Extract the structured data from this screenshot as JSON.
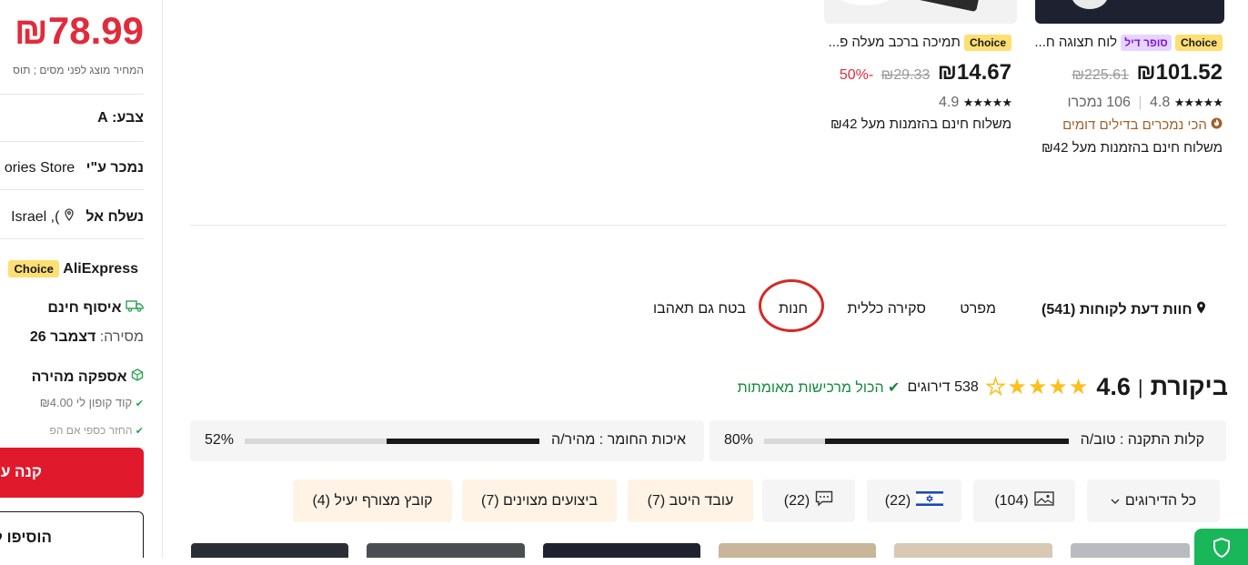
{
  "left_panel": {
    "price": "₪78.99",
    "price_note": "המחיר מוצג לפני מסים ; תוס",
    "color_label": "צבע:",
    "color_value": "A",
    "sold_by_label": "נמכר ע\"י",
    "store_name": "ories Store",
    "ship_to_label": "נשלח אל",
    "ship_to_value": "), Israel",
    "choice_badge": "Choice",
    "aliexpress": "AliExpress",
    "free_pickup": "איסוף חינם",
    "delivery_label": "מסירה:",
    "delivery_date": "דצמבר 26",
    "fast_delivery": "אספקה מהירה",
    "coupon_text": "קוד קופון לי",
    "coupon_amount": "₪4.00",
    "refund_text": "החזר כספי אם הפ",
    "buy_button": "קנה ע",
    "add_button": "הוסיפו ל"
  },
  "cards": [
    {
      "badge": "Choice",
      "superdeal": "סופר דיל",
      "title": "לוח תצוגה ח...",
      "price": "₪101.52",
      "old_price": "₪225.61",
      "stars": "★★★★★",
      "rating": "4.8",
      "sold": "106 נמכרו",
      "best_seller": "הכי נמכרים בדילים דומים",
      "shipping": "משלוח חינם בהזמנות מעל ₪42"
    },
    {
      "badge": "Choice",
      "title": "תמיכה ברכב מעלה פ...",
      "price": "₪14.67",
      "old_price": "₪29.33",
      "discount": "-50%",
      "stars": "★★★★★",
      "rating": "4.9",
      "shipping": "משלוח חינם בהזמנות מעל ₪42"
    }
  ],
  "tabs": [
    {
      "label": "חוות דעת לקוחות (541)"
    },
    {
      "label": "מפרט"
    },
    {
      "label": "סקירה כללית"
    },
    {
      "label": "חנות"
    },
    {
      "label": "בטח גם תאהבו"
    }
  ],
  "review": {
    "title": "ביקורת",
    "score": "4.6",
    "stars": "★★★★",
    "half_star": "★",
    "count": "538 דירוגים",
    "verified": "הכול מרכישות מאומתות",
    "bars": [
      {
        "label": "קלות התקנה : טוב/ה",
        "percent": "80%",
        "value": 0.8
      },
      {
        "label": "איכות החומר : מהיר/ה",
        "percent": "52%",
        "value": 0.52
      }
    ]
  },
  "filters": [
    {
      "label": "כל הדירוגים",
      "icon": "chevron-down-icon"
    },
    {
      "label": "(104)",
      "icon": "image-icon"
    },
    {
      "label": "(22)",
      "icon": "israel-flag-icon"
    },
    {
      "label": "(22)",
      "icon": "comment-icon"
    },
    {
      "label": "עובד היטב (7)"
    },
    {
      "label": "ביצועים מצוינים (7)"
    },
    {
      "label": "קובץ מצורף יעיל (4)"
    }
  ],
  "colors": {
    "price_red": "#e12b3b",
    "buy_red": "#e0192c",
    "verified_green": "#128a3e",
    "star_gold": "#fcbf1e",
    "highlight_circle": "#d42a26"
  }
}
